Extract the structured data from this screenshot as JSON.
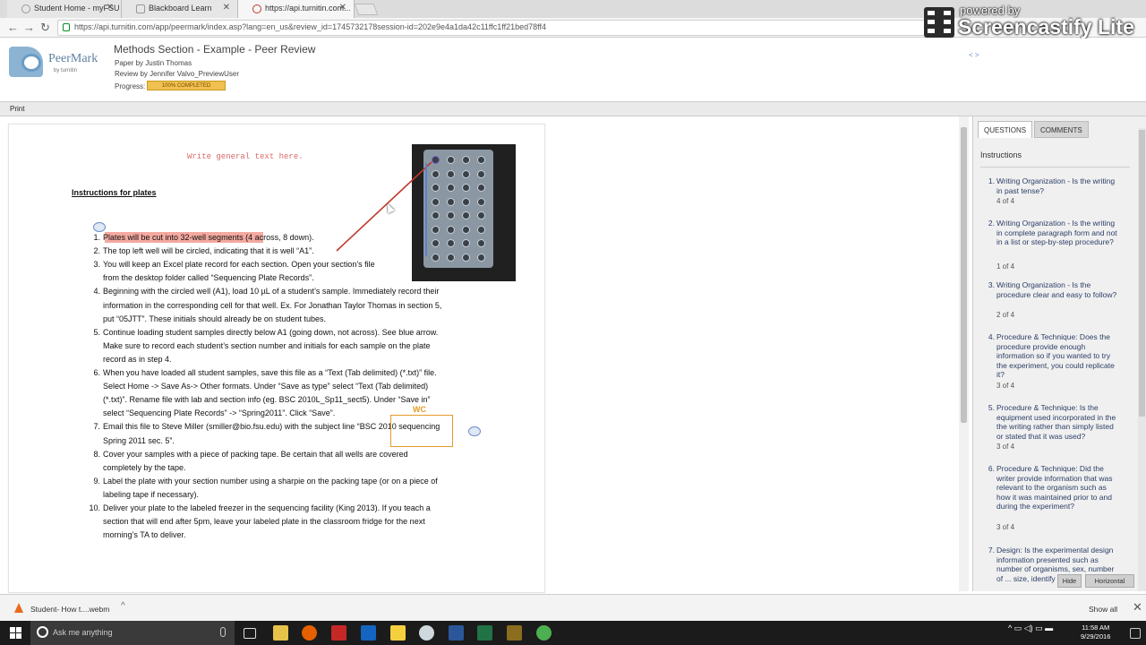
{
  "browser": {
    "tabs": [
      {
        "label": "Student Home - myFSU"
      },
      {
        "label": "Blackboard Learn"
      },
      {
        "label": "https://api.turnitin.com..."
      }
    ],
    "url": "https://api.turnitin.com/app/peermark/index.asp?lang=en_us&review_id=1745732178session-id=202e9e4a1da42c11ffc1ff21bed78ff4"
  },
  "overlay": {
    "powered_by": "powered by",
    "brand": "Screencastify Lite"
  },
  "header": {
    "logo_name": "PeerMark",
    "logo_by": "by turnitin",
    "title": "Methods Section - Example - Peer Review",
    "paper_by": "Paper by Justin Thomas",
    "review_by": "Review by Jennifer Valvo_PreviewUser",
    "progress_label": "Progress:",
    "progress_text": "100% COMPLETED",
    "progress_value": 100,
    "nav_arrows": "< >"
  },
  "toolbar": {
    "print_label": "Print"
  },
  "document": {
    "general_text": "Write general text here.",
    "instructions_heading": "Instructions for plates",
    "wc_label": "WC",
    "items": [
      {
        "n": "1.",
        "text": "Plates will be cut into 32-well segments (4 across, 8 down)."
      },
      {
        "n": "2.",
        "text": "The top left well will be circled, indicating that it is well “A1”."
      },
      {
        "n": "3.",
        "text": "You will keep an Excel plate record for each section. Open your section’s file"
      },
      {
        "n": "",
        "text": "from the desktop folder called “Sequencing Plate Records”."
      },
      {
        "n": "4.",
        "text": "Beginning with the circled well (A1), load 10 µL of a student’s sample.  Immediately record their"
      },
      {
        "n": "",
        "text": "information in the corresponding cell for that well.  Ex. For Jonathan Taylor Thomas in section 5,"
      },
      {
        "n": "",
        "text": "put “05JTT”. These initials should already be on student tubes."
      },
      {
        "n": "5.",
        "text": "Continue loading student samples directly below A1 (going down, not across).  See blue arrow."
      },
      {
        "n": "",
        "text": "Make sure to record each student’s section number and initials for each sample on the plate"
      },
      {
        "n": "",
        "text": "record as in step 4."
      },
      {
        "n": "6.",
        "text": "When you have loaded all student samples, save this file as a “Text (Tab delimited) (*.txt)” file."
      },
      {
        "n": "",
        "text": "Select Home -> Save As-> Other  formats. Under “Save as type” select “Text (Tab delimited)"
      },
      {
        "n": "",
        "text": "(*.txt)”.  Rename file with lab and section info (eg. BSC 2010L_Sp11_sect5). Under “Save in”"
      },
      {
        "n": "",
        "text": "select “Sequencing Plate Records” -> “Spring2011”. Click “Save”."
      },
      {
        "n": "7.",
        "text": "Email this file to Steve Miller (smiller@bio.fsu.edu) with the subject line “BSC 2010 sequencing"
      },
      {
        "n": "",
        "text": "Spring 2011 sec. 5”."
      },
      {
        "n": "8.",
        "text": "Cover your samples with a piece of packing tape. Be certain that all wells are covered"
      },
      {
        "n": "",
        "text": "completely by the tape."
      },
      {
        "n": "9.",
        "text": "Label the plate with your section number using a sharpie on the packing tape (or on a piece of"
      },
      {
        "n": "",
        "text": "labeling tape if necessary)."
      },
      {
        "n": "10.",
        "text": "Deliver your plate to the labeled freezer in the sequencing facility (King 2013).  If you teach a"
      },
      {
        "n": "",
        "text": "section that will end after 5pm, leave your labeled plate in the classroom fridge for the next"
      },
      {
        "n": "",
        "text": "morning’s TA to deliver."
      }
    ]
  },
  "panel": {
    "tab_questions": "QUESTIONS",
    "tab_comments": "COMMENTS",
    "instructions": "Instructions",
    "questions": [
      {
        "n": "1.",
        "text": "Writing Organization - Is the writing in past tense?",
        "score": "4 of 4"
      },
      {
        "n": "2.",
        "text": "Writing Organization - Is the writing in complete paragraph form and not in a list or step-by-step procedure?",
        "score": "1 of 4"
      },
      {
        "n": "3.",
        "text": "Writing Organization - Is the procedure clear and easy to follow?",
        "score": "2 of 4"
      },
      {
        "n": "4.",
        "text": "Procedure & Technique: Does the procedure provide enough information so if you wanted to try the experiment, you could replicate it?",
        "score": "3 of 4"
      },
      {
        "n": "5.",
        "text": "Procedure & Technique: Is the equipment used incorporated in the the writing rather than simply listed or stated that it was used?",
        "score": "3 of 4"
      },
      {
        "n": "6.",
        "text": "Procedure & Technique: Did the writer provide information that was relevant to the organism such as how it was maintained prior to and during the experiment?",
        "score": "3 of 4"
      },
      {
        "n": "7.",
        "text": "Design: Is the experimental design information presented such as number of organisms, sex, number of ... size, identify th...",
        "score": ""
      }
    ],
    "hide_label": "Hide",
    "horizontal_label": "Horizontal"
  },
  "downloads": {
    "file": "Student- How t....webm",
    "show_all": "Show all"
  },
  "taskbar": {
    "search_placeholder": "Ask me anything",
    "time": "11:58 AM",
    "date": "9/29/2016"
  }
}
